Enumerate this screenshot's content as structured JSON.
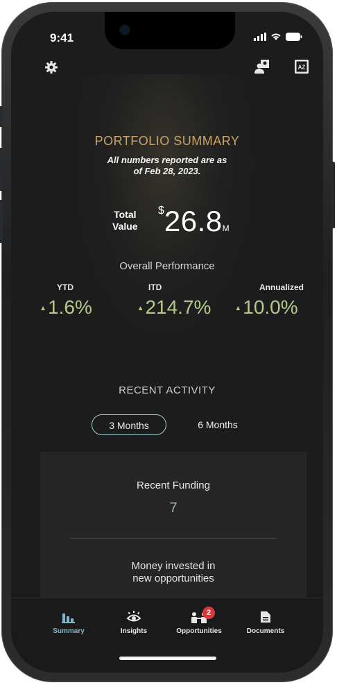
{
  "status": {
    "time": "9:41"
  },
  "header": {
    "settings_icon": "gear-icon",
    "advisor_icon": "people-icon",
    "sort_icon": "az-sort-icon",
    "sort_label": "AZ"
  },
  "summary": {
    "title": "PORTFOLIO SUMMARY",
    "subtitle_line1": "All numbers reported are as",
    "subtitle_line2": "of Feb 28, 2023.",
    "total_label_line1": "Total",
    "total_label_line2": "Value",
    "total_currency": "$",
    "total_value": "26.8",
    "total_unit": "M"
  },
  "performance": {
    "label": "Overall Performance",
    "metrics": [
      {
        "label": "YTD",
        "value": "1.6%",
        "arrow": "▲"
      },
      {
        "label": "ITD",
        "value": "214.7%",
        "arrow": "▲"
      },
      {
        "label": "Annualized",
        "value": "10.0%",
        "arrow": "▲"
      }
    ]
  },
  "recent_activity": {
    "label": "RECENT ACTIVITY",
    "periods": [
      "3 Months",
      "6 Months"
    ],
    "selected": "3 Months",
    "funding_label": "Recent Funding",
    "funding_value": "7",
    "money_label_line1": "Money invested in",
    "money_label_line2": "new opportunities"
  },
  "nav": {
    "items": [
      {
        "label": "Summary",
        "icon": "bar-chart-icon",
        "active": true
      },
      {
        "label": "Insights",
        "icon": "eye-icon"
      },
      {
        "label": "Opportunities",
        "icon": "group-icon",
        "badge": "2"
      },
      {
        "label": "Documents",
        "icon": "document-icon"
      }
    ]
  },
  "colors": {
    "accent_gold": "#c9a56a",
    "positive": "#b7c98a",
    "teal": "#8fb7b4",
    "active_nav": "#7fb6c8"
  }
}
